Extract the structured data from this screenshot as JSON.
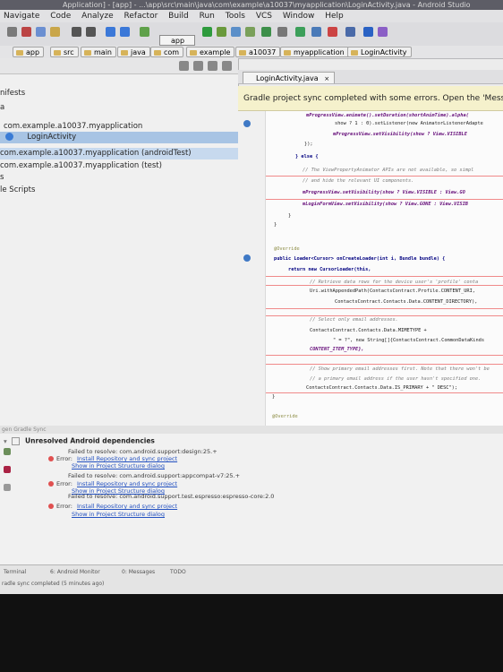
{
  "window": {
    "title": "Application] - [app] - ...\\app\\src\\main\\java\\com\\example\\a10037\\myapplication\\LoginActivity.java - Android Studio"
  },
  "menu": [
    "Navigate",
    "Code",
    "Analyze",
    "Refactor",
    "Build",
    "Run",
    "Tools",
    "VCS",
    "Window",
    "Help"
  ],
  "toolbar": {
    "run_config": "app"
  },
  "breadcrumb": [
    "app",
    "src",
    "main",
    "java",
    "com",
    "example",
    "a10037",
    "myapplication",
    "LoginActivity"
  ],
  "project_tree": [
    "nifests",
    "a",
    "com.example.a10037.myapplication",
    "LoginActivity",
    "com.example.a10037.myapplication (androidTest)",
    "com.example.a10037.myapplication (test)",
    "s",
    "le Scripts"
  ],
  "editor": {
    "tab_label": "LoginActivity.java",
    "banner": "Gradle project sync completed with some errors. Open the 'Messages' view to",
    "code_lines": [
      "mProgressView.animate().setDuration(shortAnimTime).alpha(",
      "show ? 1 : 0).setListener(new AnimatorListenerAdapte",
      "mProgressView.setVisibility(show ? View.VISIBLE",
      "});",
      "} else {",
      "// The ViewPropertyAnimator APIs are not available, so simpl",
      "// and hide the relevant UI components.",
      "mProgressView.setVisibility(show ? View.VISIBLE : View.GO",
      "mLoginFormView.setVisibility(show ? View.GONE : View.VISIB",
      "}",
      "}",
      "@Override",
      "public Loader<Cursor> onCreateLoader(int i, Bundle bundle) {",
      "return new CursorLoader(this,",
      "// Retrieve data rows for the device user's 'profile' conta",
      "Uri.withAppendedPath(ContactsContract.Profile.CONTENT_URI,",
      "ContactsContract.Contacts.Data.CONTENT_DIRECTORY),",
      "// Select only email addresses.",
      "ContactsContract.Contacts.Data.MIMETYPE +",
      "\" = ?\", new String[]{ContactsContract.CommonDataKinds",
      "CONTENT_ITEM_TYPE},",
      "// Show primary email addresses first. Note that there won't be",
      "// a primary email address if the user hasn't specified one.",
      "ContactsContract.Contacts.Data.IS_PRIMARY + \" DESC\");",
      "}",
      "@Override"
    ]
  },
  "gradle_sync": {
    "panel_title": "gen Gradle Sync",
    "header": "Unresolved Android dependencies",
    "failures": [
      {
        "message": "Failed to resolve: com.android.support:design:25.+",
        "link1": "Install Repository and sync project",
        "link2": "Show in Project Structure dialog"
      },
      {
        "message": "Failed to resolve: com.android.support:appcompat-v7:25.+",
        "link1": "Install Repository and sync project",
        "link2": "Show in Project Structure dialog"
      },
      {
        "message": "Failed to resolve: com.android.support.test.espresso:espresso-core:2.0",
        "link1": "Install Repository and sync project",
        "link2": "Show in Project Structure dialog"
      }
    ],
    "error_label": "Error:"
  },
  "status": {
    "tabs": [
      "Terminal",
      "6: Android Monitor",
      "0: Messages",
      "TODO"
    ],
    "message": "radle sync completed (5 minutes ago)"
  },
  "colors": {
    "selection": "#a8c4e4",
    "banner": "#f5f1cc",
    "error": "#e05050",
    "link": "#2250c0"
  }
}
